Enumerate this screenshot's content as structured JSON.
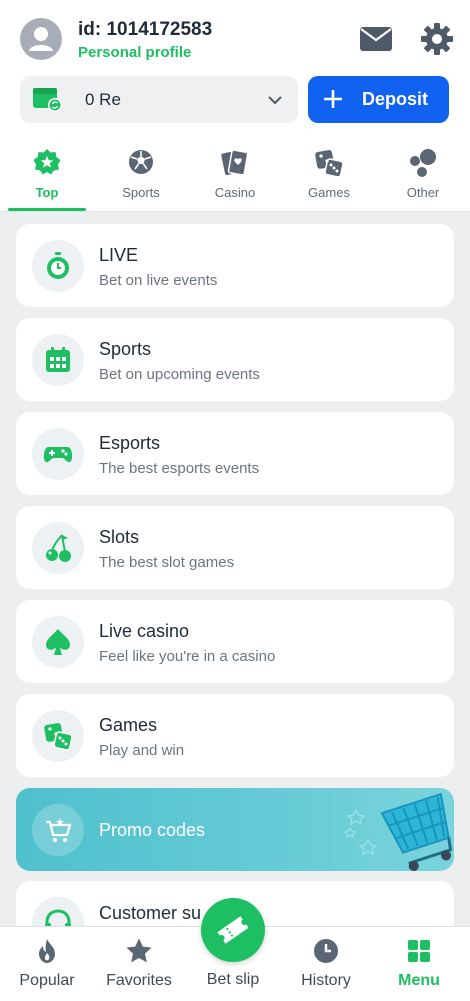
{
  "profile": {
    "id_text": "id: 1014172583",
    "link_label": "Personal profile",
    "avatar_icon": "user-avatar-icon",
    "mail_icon": "mail-icon",
    "settings_icon": "gear-icon"
  },
  "balance": {
    "value": "0 Re",
    "wallet_icon": "wallet-icon",
    "dropdown_icon": "chevron-down-icon"
  },
  "deposit": {
    "label": "Deposit",
    "icon": "plus-icon"
  },
  "tabs": [
    {
      "label": "Top",
      "icon": "star-badge-icon",
      "active": true
    },
    {
      "label": "Sports",
      "icon": "soccer-ball-icon",
      "active": false
    },
    {
      "label": "Casino",
      "icon": "playing-card-icon",
      "active": false
    },
    {
      "label": "Games",
      "icon": "dice-icon",
      "active": false
    },
    {
      "label": "Other",
      "icon": "bubbles-icon",
      "active": false
    }
  ],
  "menu": [
    {
      "title": "LIVE",
      "subtitle": "Bet on live events",
      "icon": "stopwatch-icon"
    },
    {
      "title": "Sports",
      "subtitle": "Bet on upcoming events",
      "icon": "calendar-icon"
    },
    {
      "title": "Esports",
      "subtitle": "The best esports events",
      "icon": "gamepad-icon"
    },
    {
      "title": "Slots",
      "subtitle": "The best slot games",
      "icon": "cherries-icon"
    },
    {
      "title": "Live casino",
      "subtitle": "Feel like you're in a casino",
      "icon": "spade-icon"
    },
    {
      "title": "Games",
      "subtitle": "Play and win",
      "icon": "dice-icon"
    }
  ],
  "promo": {
    "title": "Promo codes",
    "icon": "cart-icon",
    "illustration": "shopping-basket-icon"
  },
  "partial_item": {
    "title": "Customer su",
    "icon": "headset-icon"
  },
  "bottom_nav": [
    {
      "label": "Popular",
      "icon": "flame-icon",
      "active": false
    },
    {
      "label": "Favorites",
      "icon": "star-icon",
      "active": false
    },
    {
      "label": "Bet slip",
      "icon": "ticket-icon",
      "active": false
    },
    {
      "label": "History",
      "icon": "clock-icon",
      "active": false
    },
    {
      "label": "Menu",
      "icon": "grid-icon",
      "active": true
    }
  ],
  "colors": {
    "accent_green": "#1dbf62",
    "deposit_blue": "#1162f0",
    "promo_teal": "#5cc6d2",
    "background": "#eceef0"
  }
}
